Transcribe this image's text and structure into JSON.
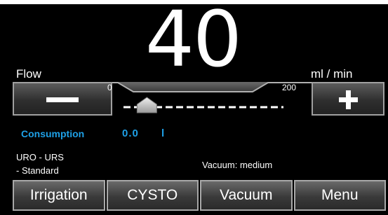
{
  "flow": {
    "label": "Flow",
    "value": "40",
    "unit": "ml / min",
    "scale_min": "0",
    "scale_max": "200",
    "level_fraction": 0.2
  },
  "controls": {
    "decrease_icon": "minus-icon",
    "increase_icon": "plus-icon"
  },
  "consumption": {
    "label": "Consumption",
    "value": "0.0",
    "unit": "l"
  },
  "program": {
    "line1": "URO - URS",
    "line2": "- Standard"
  },
  "vacuum_status": "Vacuum: medium",
  "tabs": [
    {
      "label": "Irrigation"
    },
    {
      "label": "CYSTO"
    },
    {
      "label": "Vacuum"
    },
    {
      "label": "Menu"
    }
  ],
  "colors": {
    "background": "#000000",
    "accent": "#1ea0e6",
    "text": "#ffffff"
  }
}
